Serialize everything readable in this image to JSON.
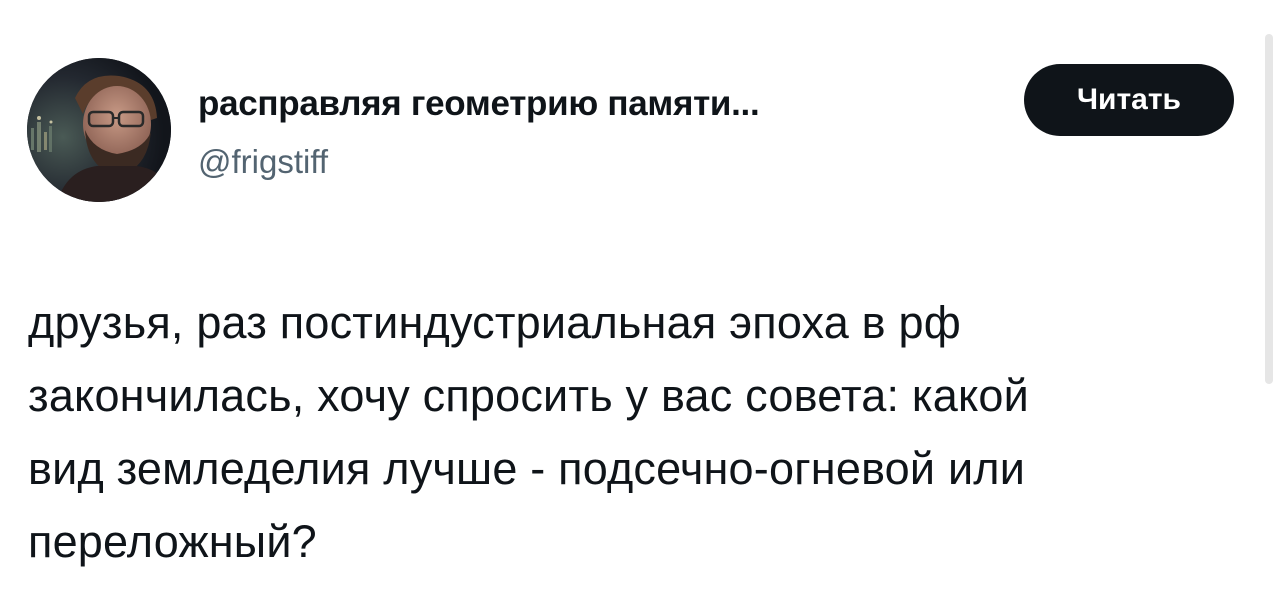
{
  "author": {
    "display_name": "расправляя геометрию памяти...",
    "handle": "@frigstiff",
    "avatar_icon": "user-avatar-photo"
  },
  "follow_button": {
    "label": "Читать"
  },
  "tweet": {
    "lines": [
      "друзья, раз постиндустриальная эпоха в рф",
      "закончилась, хочу спросить у вас совета: какой",
      "вид земледелия лучше - подсечно-огневой или",
      "переложный?"
    ]
  },
  "colors": {
    "text_primary": "#0f1419",
    "text_secondary": "#536471",
    "button_bg": "#0f1419",
    "button_text": "#ffffff"
  }
}
